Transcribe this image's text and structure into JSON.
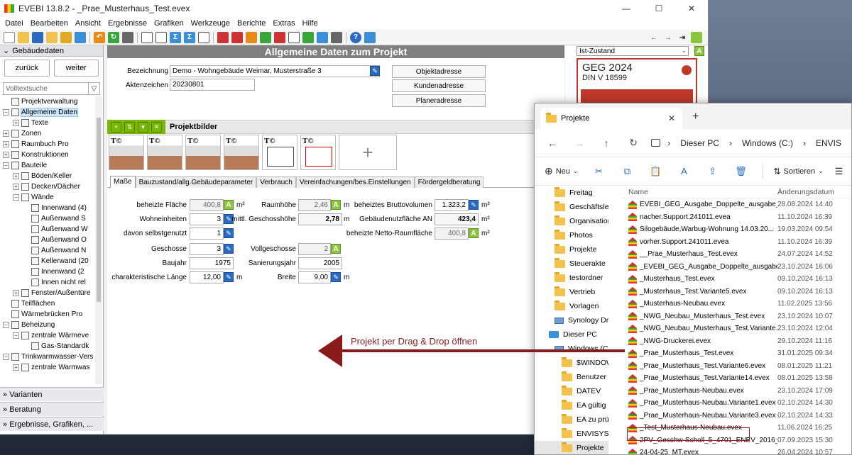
{
  "window": {
    "title": "EVEBI 13.8.2 - _Prae_Musterhaus_Test.evex",
    "min": "—",
    "max": "☐",
    "close": "✕"
  },
  "menu": [
    "Datei",
    "Bearbeiten",
    "Ansicht",
    "Ergebnisse",
    "Grafiken",
    "Werkzeuge",
    "Berichte",
    "Extras",
    "Hilfe"
  ],
  "nav": {
    "header": "Gebäudedaten",
    "back": "zurück",
    "forward": "weiter",
    "search_placeholder": "Volltextsuche",
    "tree": [
      {
        "label": "Projektverwaltung",
        "level": 1,
        "pm": ""
      },
      {
        "label": "Allgemeine Daten",
        "level": 1,
        "pm": "−",
        "selected": true
      },
      {
        "label": "Texte",
        "level": 2,
        "pm": "+"
      },
      {
        "label": "Zonen",
        "level": 1,
        "pm": "+"
      },
      {
        "label": "Raumbuch Pro",
        "level": 1,
        "pm": "+"
      },
      {
        "label": "Konstruktionen",
        "level": 1,
        "pm": "+"
      },
      {
        "label": "Bauteile",
        "level": 1,
        "pm": "−"
      },
      {
        "label": "Böden/Keller",
        "level": 2,
        "pm": "+"
      },
      {
        "label": "Decken/Dächer",
        "level": 2,
        "pm": "+"
      },
      {
        "label": "Wände",
        "level": 2,
        "pm": "−"
      },
      {
        "label": "Innenwand (4)",
        "level": 3,
        "pm": ""
      },
      {
        "label": "Außenwand S",
        "level": 3,
        "pm": ""
      },
      {
        "label": "Außenwand W",
        "level": 3,
        "pm": ""
      },
      {
        "label": "Außenwand O",
        "level": 3,
        "pm": ""
      },
      {
        "label": "Außenwand N",
        "level": 3,
        "pm": ""
      },
      {
        "label": "Kellerwand (20",
        "level": 3,
        "pm": ""
      },
      {
        "label": "Innenwand (2",
        "level": 3,
        "pm": ""
      },
      {
        "label": "Innen nicht rel",
        "level": 3,
        "pm": ""
      },
      {
        "label": "Fenster/Außentüre",
        "level": 2,
        "pm": "+"
      },
      {
        "label": "Teilflächen",
        "level": 1,
        "pm": ""
      },
      {
        "label": "Wärmebrücken Pro",
        "level": 1,
        "pm": ""
      },
      {
        "label": "Beheizung",
        "level": 1,
        "pm": "−"
      },
      {
        "label": "zentrale Wärmeve",
        "level": 2,
        "pm": "−"
      },
      {
        "label": "Gas-Standardk",
        "level": 3,
        "pm": ""
      },
      {
        "label": "Trinkwarmwasser-Vers",
        "level": 1,
        "pm": "−"
      },
      {
        "label": "zentrale Warmwas",
        "level": 2,
        "pm": "+"
      }
    ],
    "bottom": [
      "Varianten",
      "Beratung",
      "Ergebnisse, Grafiken, ..."
    ]
  },
  "main": {
    "title": "Allgemeine Daten zum Projekt",
    "bezeichnung_label": "Bezeichnung",
    "bezeichnung_value": "Demo - Wohngebäude Weimar, Musterstraße 3",
    "aktenzeichen_label": "Aktenzeichen",
    "aktenzeichen_value": "20230801",
    "buttons": [
      "Objektadresse",
      "Kundenadresse",
      "Planeradresse"
    ],
    "projektbilder": "Projektbilder",
    "tabs": [
      "Maße",
      "Bauzustand/allg.Gebäudeparameter",
      "Verbrauch",
      "Vereinfachungen/bes.Einstellungen",
      "Fördergeldberatung"
    ],
    "fields": {
      "beheizte_flaeche": {
        "label": "beheizte Fläche",
        "value": "400,8",
        "unit": "m²"
      },
      "wohneinheiten": {
        "label": "Wohneinheiten",
        "value": "3"
      },
      "davon_selbstgenutzt": {
        "label": "davon selbstgenutzt",
        "value": "1"
      },
      "geschosse": {
        "label": "Geschosse",
        "value": "3"
      },
      "baujahr": {
        "label": "Baujahr",
        "value": "1975"
      },
      "char_laenge": {
        "label": "charakteristische Länge",
        "value": "12,00",
        "unit": "m"
      },
      "raumhoehe": {
        "label": "Raumhöhe",
        "value": "2,46",
        "unit": "m"
      },
      "geschosshoehe": {
        "label": "mittl. Geschosshöhe",
        "value": "2,78",
        "unit": "m"
      },
      "vollgeschosse": {
        "label": "Vollgeschosse",
        "value": "2"
      },
      "sanierungsjahr": {
        "label": "Sanierungsjahr",
        "value": "2005"
      },
      "breite": {
        "label": "Breite",
        "value": "9,00",
        "unit": "m"
      },
      "bruttovolumen": {
        "label": "beheiztes Bruttovolumen",
        "value": "1.323,2",
        "unit": "m³"
      },
      "nutzflaeche": {
        "label": "Gebäudenutzfläche AN",
        "value": "423,4",
        "unit": "m²"
      },
      "netto_raumflaeche": {
        "label": "beheizte Netto-Raumfläche",
        "value": "400,8",
        "unit": "m²"
      }
    }
  },
  "geg": {
    "state": "Ist-Zustand",
    "title": "GEG 2024",
    "norm": "DIN V 18599"
  },
  "explorer": {
    "tab_title": "Projekte",
    "breadcrumb": [
      "Dieser PC",
      "Windows (C:)",
      "ENVIS"
    ],
    "commands": {
      "new": "Neu",
      "sort": "Sortieren"
    },
    "col_name": "Name",
    "col_date": "Änderungsdatum",
    "left": [
      {
        "label": "Freitag",
        "kind": "folder"
      },
      {
        "label": "Geschäftsleit",
        "kind": "folder"
      },
      {
        "label": "Organisation",
        "kind": "folder"
      },
      {
        "label": "Photos",
        "kind": "folder"
      },
      {
        "label": "Projekte",
        "kind": "folder"
      },
      {
        "label": "Steuerakte",
        "kind": "folder"
      },
      {
        "label": "testordner",
        "kind": "folder"
      },
      {
        "label": "Vertrieb",
        "kind": "folder"
      },
      {
        "label": "Vorlagen",
        "kind": "folder"
      },
      {
        "label": "Synology Driv",
        "kind": "drive"
      },
      {
        "label": "Dieser PC",
        "kind": "pc"
      },
      {
        "label": "Windows (C",
        "kind": "drive"
      },
      {
        "label": "$WINDOW",
        "kind": "folder"
      },
      {
        "label": "Benutzer",
        "kind": "folder"
      },
      {
        "label": "DATEV",
        "kind": "folder"
      },
      {
        "label": "EA gültig",
        "kind": "folder"
      },
      {
        "label": "EA zu prüf",
        "kind": "folder"
      },
      {
        "label": "ENVISYS",
        "kind": "folder"
      },
      {
        "label": "Projekte",
        "kind": "folder",
        "selected": true
      }
    ],
    "files": [
      {
        "name": "EVEBI_GEG_Ausgabe_Doppelte_ausgabe_...",
        "date": "28.08.2024 14:40"
      },
      {
        "name": "nacher.Support.241011.evea",
        "date": "11.10.2024 16:39"
      },
      {
        "name": "Silogebäude,Warbug-Wohnung 14.03.20...",
        "date": "19.03.2024 09:54"
      },
      {
        "name": "vorher.Support.241011.evea",
        "date": "11.10.2024 16:39"
      },
      {
        "name": "__Prae_Musterhaus_Test.evex",
        "date": "24.07.2024 14:52"
      },
      {
        "name": "_EVEBI_GEG_Ausgabe_Doppelte_ausgabe...",
        "date": "23.10.2024 16:06"
      },
      {
        "name": "_Musterhaus_Test.evex",
        "date": "09.10.2024 16:13"
      },
      {
        "name": "_Musterhaus_Test.Variante5.evex",
        "date": "09.10.2024 16:13"
      },
      {
        "name": "_Musterhaus-Neubau.evex",
        "date": "11.02.2025 13:56"
      },
      {
        "name": "_NWG_Neubau_Musterhaus_Test.evex",
        "date": "23.10.2024 10:07"
      },
      {
        "name": "_NWG_Neubau_Musterhaus_Test.Variante...",
        "date": "23.10.2024 12:04"
      },
      {
        "name": "_NWG-Druckerei.evex",
        "date": "29.10.2024 11:16"
      },
      {
        "name": "_Prae_Musterhaus_Test.evex",
        "date": "31.01.2025 09:34"
      },
      {
        "name": "_Prae_Musterhaus_Test.Variante6.evex",
        "date": "08.01.2025 11:21"
      },
      {
        "name": "_Prae_Musterhaus_Test.Variante14.evex",
        "date": "08.01.2025 13:58"
      },
      {
        "name": "_Prae_Musterhaus-Neubau.evex",
        "date": "23.10.2024 17:09"
      },
      {
        "name": "_Prae_Musterhaus-Neubau.Variante1.evex",
        "date": "02.10.2024 14:30"
      },
      {
        "name": "_Prae_Musterhaus-Neubau.Variante3.evex",
        "date": "02.10.2024 14:33"
      },
      {
        "name": "_Test_Musterhaus-Neubau.evex",
        "date": "11.06.2024 16:25"
      },
      {
        "name": "2PV_Geschw-Scholl_5_4701_ENEV_2016_...",
        "date": "07.09.2023 15:30"
      },
      {
        "name": "24-04-25_MT.evex",
        "date": "26.04.2024 10:57"
      }
    ]
  },
  "annotation": "Projekt per Drag & Drop öffnen",
  "colors": {
    "accent_green": "#8cc63f",
    "edit_blue": "#2a6bc1",
    "arrow_red": "#8b1a1a",
    "geg_red": "#c0392b"
  }
}
